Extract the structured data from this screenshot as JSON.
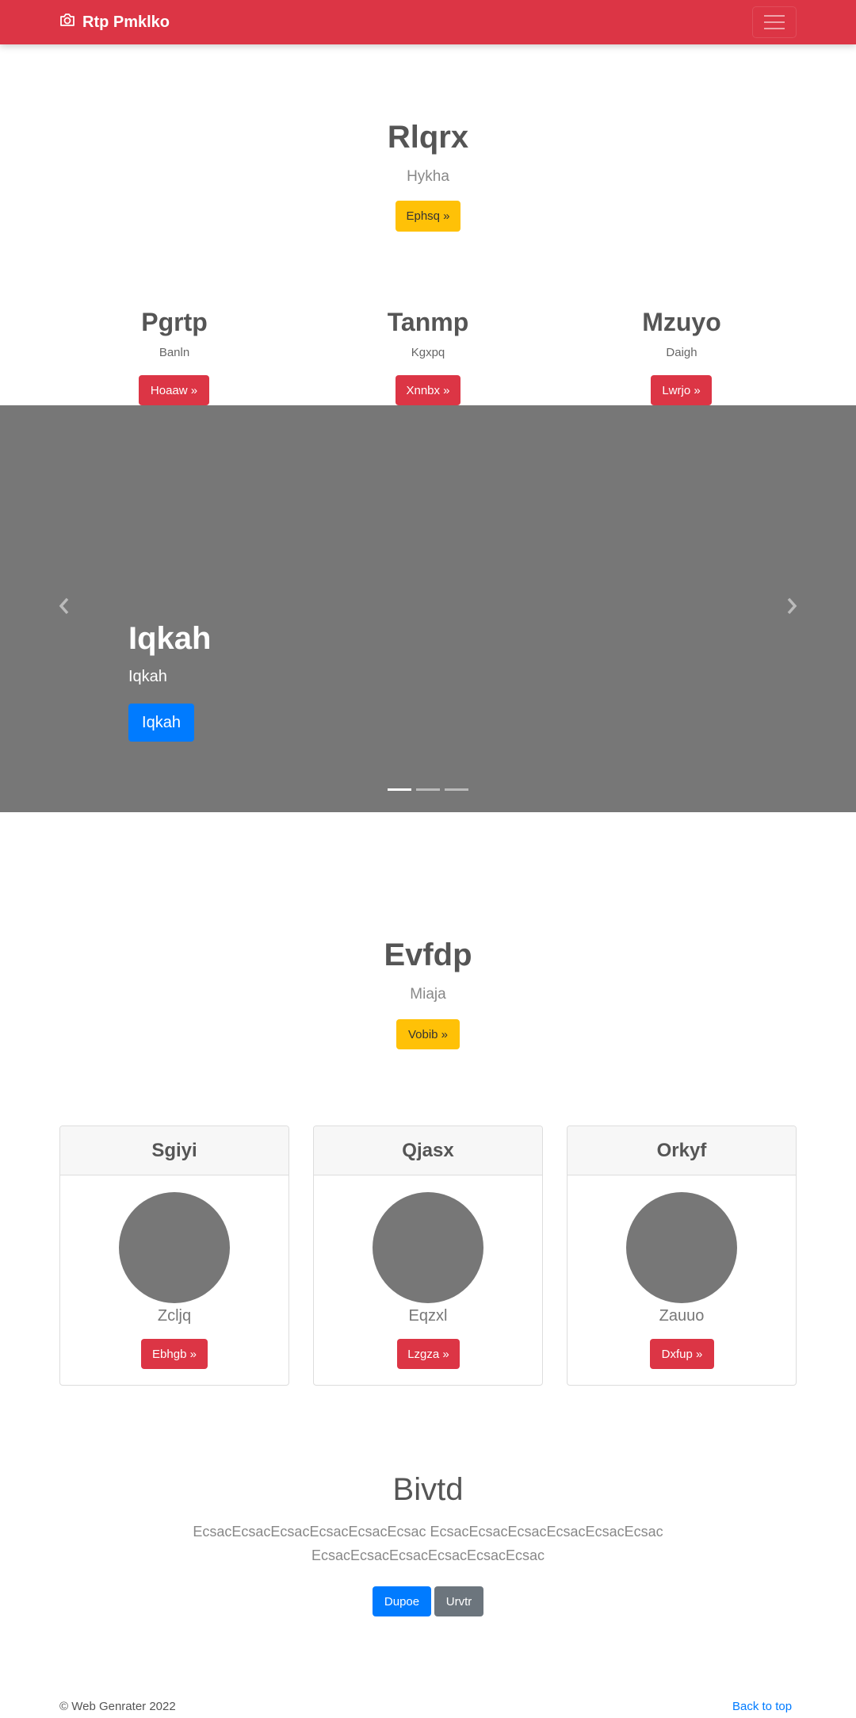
{
  "navbar": {
    "brand": "Rtp Pmklko",
    "brand_icon": "camera-icon",
    "toggler_icon": "hamburger-icon"
  },
  "hero1": {
    "title": "Rlqrx",
    "subtitle": "Hykha",
    "button": "Ephsq »"
  },
  "columns": [
    {
      "title": "Pgrtp",
      "subtitle": "Banln",
      "button": "Hoaaw »"
    },
    {
      "title": "Tanmp",
      "subtitle": "Kgxpq",
      "button": "Xnnbx »"
    },
    {
      "title": "Mzuyo",
      "subtitle": "Daigh",
      "button": "Lwrjo »"
    }
  ],
  "carousel": {
    "title": "Iqkah",
    "subtitle": "Iqkah",
    "button": "Iqkah",
    "prev_icon": "chevron-left-icon",
    "next_icon": "chevron-right-icon",
    "active_slide": 1,
    "slide_count": 3
  },
  "hero2": {
    "title": "Evfdp",
    "subtitle": "Miaja",
    "button": "Vobib »"
  },
  "cards": [
    {
      "header": "Sgiyi",
      "text": "Zcljq",
      "button": "Ebhgb »"
    },
    {
      "header": "Qjasx",
      "text": "Eqzxl",
      "button": "Lzgza »"
    },
    {
      "header": "Orkyf",
      "text": "Zauuo",
      "button": "Dxfup »"
    }
  ],
  "jumbotron": {
    "title": "Bivtd",
    "text": "EcsacEcsacEcsacEcsacEcsacEcsac EcsacEcsacEcsacEcsacEcsacEcsac EcsacEcsacEcsacEcsacEcsacEcsac",
    "primary_button": "Dupoe",
    "secondary_button": "Urvtr"
  },
  "footer": {
    "copyright": "© Web Genrater 2022",
    "back_to_top": "Back to top"
  },
  "colors": {
    "navbar": "#dc3545",
    "warning": "#ffc107",
    "primary": "#007bff",
    "secondary": "#6c757d",
    "placeholder": "#777777"
  }
}
